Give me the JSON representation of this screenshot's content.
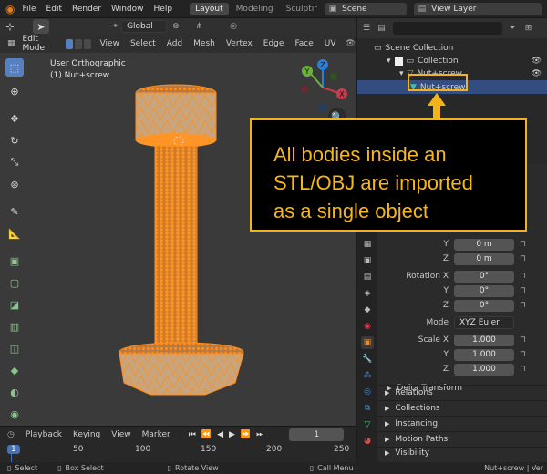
{
  "app_icon": "blender-logo-icon",
  "menu": [
    "File",
    "Edit",
    "Render",
    "Window",
    "Help"
  ],
  "workspaces": [
    {
      "label": "Layout",
      "active": true
    },
    {
      "label": "Modeling",
      "active": false
    },
    {
      "label": "Sculptin",
      "active": false
    }
  ],
  "scene": {
    "name": "Scene"
  },
  "view_layer": {
    "name": "View Layer"
  },
  "viewport_header": {
    "transform": "Global"
  },
  "edit_header": {
    "mode": "Edit Mode",
    "menus": [
      "View",
      "Select",
      "Add",
      "Mesh",
      "Vertex",
      "Edge",
      "Face",
      "UV"
    ]
  },
  "viewport": {
    "view_name": "User Orthographic",
    "object_name": "(1) Nut+screw",
    "gizmo_axes": {
      "x": "X",
      "y": "Y",
      "z": "Z"
    }
  },
  "outliner": {
    "root": "Scene Collection",
    "collection": "Collection",
    "object": "Nut+screw",
    "mesh": "Nut+screw"
  },
  "callout": {
    "lines": [
      "All bodies inside an",
      "STL/OBJ are imported",
      "as a single object"
    ],
    "color": "#f2b417"
  },
  "properties": {
    "location": {
      "label": "Location X",
      "y_label": "Y",
      "z_label": "Z",
      "y": "0 m",
      "z": "0 m"
    },
    "rotation": {
      "label": "Rotation X",
      "y_label": "Y",
      "z_label": "Z",
      "x": "0°",
      "y": "0°",
      "z": "0°"
    },
    "mode": {
      "label": "Mode",
      "value": "XYZ Euler"
    },
    "scale": {
      "label": "Scale X",
      "y_label": "Y",
      "z_label": "Z",
      "x": "1.000",
      "y": "1.000",
      "z": "1.000"
    },
    "delta": "Delta Transform",
    "sections": [
      "Relations",
      "Collections",
      "Instancing",
      "Motion Paths",
      "Visibility"
    ]
  },
  "timeline": {
    "menus": [
      "Playback",
      "Keying",
      "View",
      "Marker"
    ],
    "current_frame": "1",
    "ticks": [
      "1",
      "50",
      "100",
      "150",
      "200",
      "250"
    ]
  },
  "status_bar": {
    "items": [
      "Select",
      "Box Select",
      "Rotate View",
      "Call Menu"
    ],
    "right": "Nut+screw | Ver"
  }
}
